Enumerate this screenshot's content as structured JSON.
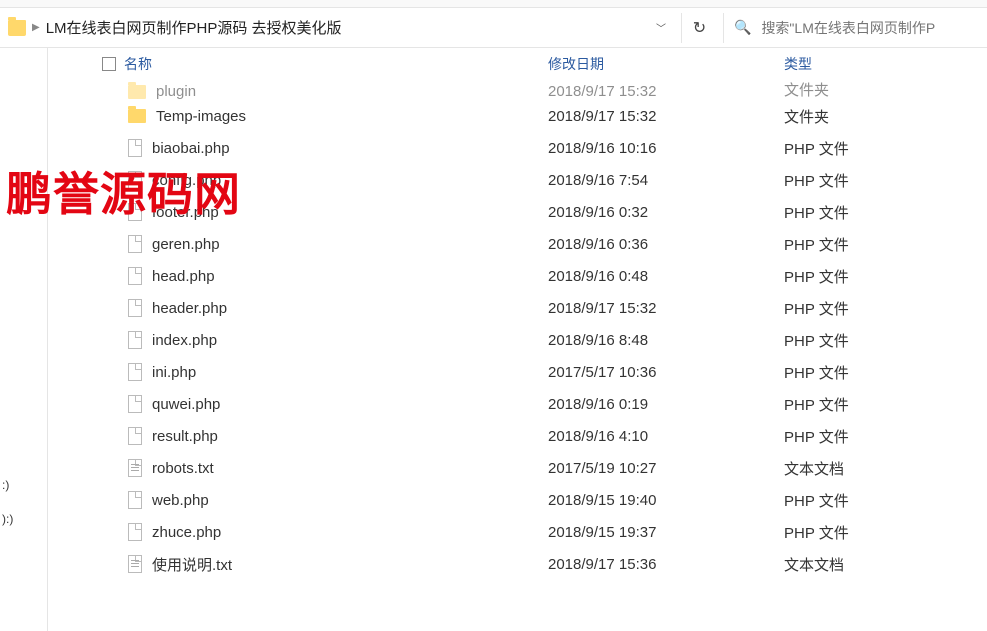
{
  "path": {
    "folder_name": "LM在线表白网页制作PHP源码 去授权美化版"
  },
  "search": {
    "placeholder": "搜索\"LM在线表白网页制作P"
  },
  "columns": {
    "name": "名称",
    "date": "修改日期",
    "type": "类型"
  },
  "partial_row": {
    "name": "plugin",
    "date": "2018/9/17 15:32",
    "type": "文件夹",
    "icon": "folder"
  },
  "files": [
    {
      "name": "Temp-images",
      "date": "2018/9/17 15:32",
      "type": "文件夹",
      "icon": "folder"
    },
    {
      "name": "biaobai.php",
      "date": "2018/9/16 10:16",
      "type": "PHP 文件",
      "icon": "file"
    },
    {
      "name": "config.php",
      "date": "2018/9/16 7:54",
      "type": "PHP 文件",
      "icon": "file"
    },
    {
      "name": "footer.php",
      "date": "2018/9/16 0:32",
      "type": "PHP 文件",
      "icon": "file"
    },
    {
      "name": "geren.php",
      "date": "2018/9/16 0:36",
      "type": "PHP 文件",
      "icon": "file"
    },
    {
      "name": "head.php",
      "date": "2018/9/16 0:48",
      "type": "PHP 文件",
      "icon": "file"
    },
    {
      "name": "header.php",
      "date": "2018/9/17 15:32",
      "type": "PHP 文件",
      "icon": "file"
    },
    {
      "name": "index.php",
      "date": "2018/9/16 8:48",
      "type": "PHP 文件",
      "icon": "file"
    },
    {
      "name": "ini.php",
      "date": "2017/5/17 10:36",
      "type": "PHP 文件",
      "icon": "file"
    },
    {
      "name": "quwei.php",
      "date": "2018/9/16 0:19",
      "type": "PHP 文件",
      "icon": "file"
    },
    {
      "name": "result.php",
      "date": "2018/9/16 4:10",
      "type": "PHP 文件",
      "icon": "file"
    },
    {
      "name": "robots.txt",
      "date": "2017/5/19 10:27",
      "type": "文本文档",
      "icon": "txt"
    },
    {
      "name": "web.php",
      "date": "2018/9/15 19:40",
      "type": "PHP 文件",
      "icon": "file"
    },
    {
      "name": "zhuce.php",
      "date": "2018/9/15 19:37",
      "type": "PHP 文件",
      "icon": "file"
    },
    {
      "name": "使用说明.txt",
      "date": "2018/9/17 15:36",
      "type": "文本文档",
      "icon": "txt"
    }
  ],
  "sidebar": {
    "items": [
      ":)",
      "):)"
    ]
  },
  "watermark": "鹏誉源码网"
}
